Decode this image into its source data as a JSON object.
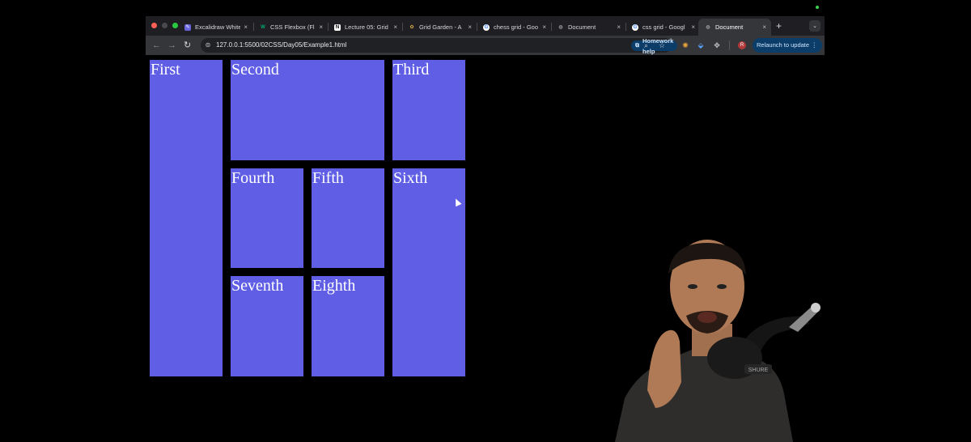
{
  "browser": {
    "tabs": [
      {
        "title": "Excalidraw White",
        "favicon": "excalidraw-icon",
        "active": false
      },
      {
        "title": "CSS Flexbox (Fl",
        "favicon": "w3-icon",
        "active": false
      },
      {
        "title": "Lecture 05: Grid",
        "favicon": "notion-icon",
        "active": false
      },
      {
        "title": "Grid Garden - A",
        "favicon": "garden-icon",
        "active": false
      },
      {
        "title": "chess grid - Goo",
        "favicon": "google-icon",
        "active": false
      },
      {
        "title": "Document",
        "favicon": "globe-icon",
        "active": false
      },
      {
        "title": "css grid - Googl",
        "favicon": "google-icon",
        "active": false
      },
      {
        "title": "Document",
        "favicon": "globe-icon",
        "active": true
      }
    ],
    "new_tab": "+",
    "close_glyph": "×",
    "url": "127.0.0.1:5500/02CSS/Day05/Example1.html",
    "homework_help": "Homework help",
    "avatar_initial": "R",
    "relaunch": "Relaunch to update",
    "accent": "#0b3d68"
  },
  "page": {
    "background": "#000000",
    "box_color": "#5f5ee5",
    "items": [
      {
        "label": "First"
      },
      {
        "label": "Second"
      },
      {
        "label": "Third"
      },
      {
        "label": "Fourth"
      },
      {
        "label": "Fifth"
      },
      {
        "label": "Sixth"
      },
      {
        "label": "Seventh"
      },
      {
        "label": "Eighth"
      }
    ]
  }
}
